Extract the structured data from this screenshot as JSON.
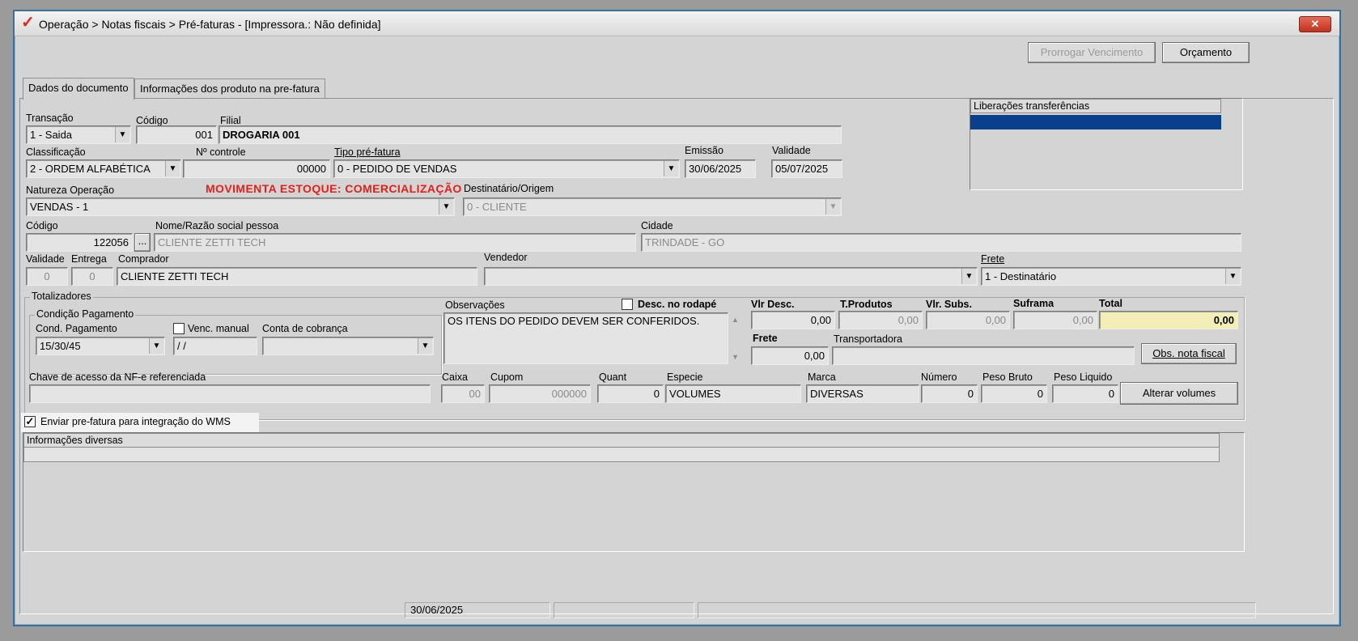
{
  "window": {
    "title": "Operação > Notas fiscais > Pré-faturas - [Impressora.: Não definida]",
    "close_label": "✕"
  },
  "toolbar": {
    "prorrogar_label": "Prorrogar Vencimento",
    "orcamento_label": "Orçamento"
  },
  "tabs": [
    {
      "label": "Dados do documento"
    },
    {
      "label": "Informações dos produto na pre-fatura"
    }
  ],
  "form": {
    "transacao": {
      "label": "Transação",
      "value": "1 - Saida"
    },
    "codigo_filial": {
      "label": "Código",
      "value": "001"
    },
    "filial": {
      "label": "Filial",
      "value": "DROGARIA 001"
    },
    "classificacao": {
      "label": "Classificação",
      "value": "2 - ORDEM ALFABÉTICA"
    },
    "n_controle": {
      "label": "Nº controle",
      "value": "00000"
    },
    "tipo_prefatura": {
      "label": "Tipo pré-fatura",
      "value": "0  - PEDIDO DE VENDAS"
    },
    "emissao": {
      "label": "Emissão",
      "value": "30/06/2025"
    },
    "validade_doc": {
      "label": "Validade",
      "value": "05/07/2025"
    },
    "natureza": {
      "label": "Natureza  Operação",
      "value": "VENDAS - 1"
    },
    "movimenta_estoque": "MOVIMENTA ESTOQUE: COMERCIALIZAÇÃO",
    "destinatario": {
      "label": "Destinatário/Origem",
      "value": "0 - CLIENTE"
    },
    "codigo_pessoa": {
      "label": "Código",
      "value": "122056",
      "lookup": "..."
    },
    "nome_pessoa": {
      "label": "Nome/Razão social pessoa",
      "value": "CLIENTE ZETTI TECH"
    },
    "cidade": {
      "label": "Cidade",
      "value": "TRINDADE - GO"
    },
    "validade": {
      "label": "Validade",
      "value": "0"
    },
    "entrega": {
      "label": "Entrega",
      "value": "0"
    },
    "comprador": {
      "label": "Comprador",
      "value": "CLIENTE ZETTI TECH"
    },
    "vendedor": {
      "label": "Vendedor",
      "value": ""
    },
    "frete_tipo": {
      "label": "Frete",
      "value": "1 - Destinatário"
    }
  },
  "liberacoes": {
    "header": "Liberações transferências"
  },
  "totalizadores": {
    "title": "Totalizadores",
    "condicao_title": "Condição Pagamento",
    "cond_pagamento": {
      "label": "Cond. Pagamento",
      "value": "15/30/45"
    },
    "venc_manual": {
      "label": "Venc. manual",
      "value": "/ /"
    },
    "conta_cobranca": {
      "label": "Conta de cobrança",
      "value": ""
    },
    "observacoes": {
      "label": "Observações",
      "value": "OS ITENS DO PEDIDO DEVEM SER CONFERIDOS."
    },
    "desc_rodape": "Desc. no rodapé",
    "vlr_desc": {
      "label": "Vlr Desc.",
      "value": "0,00"
    },
    "t_produtos": {
      "label": "T.Produtos",
      "value": "0,00"
    },
    "vlr_subs": {
      "label": "Vlr. Subs.",
      "value": "0,00"
    },
    "suframa": {
      "label": "Suframa",
      "value": "0,00"
    },
    "total": {
      "label": "Total",
      "value": "0,00"
    },
    "frete": {
      "label": "Frete",
      "value": "0,00"
    },
    "transportadora": {
      "label": "Transportadora",
      "value": ""
    },
    "obs_nota_fiscal_label": "Obs. nota fiscal",
    "chave_acesso": {
      "label": "Chave de acesso da NF-e referenciada",
      "value": ""
    },
    "caixa": {
      "label": "Caixa",
      "value": "00"
    },
    "cupom": {
      "label": "Cupom",
      "value": "000000"
    },
    "quant": {
      "label": "Quant",
      "value": "0"
    },
    "especie": {
      "label": "Especie",
      "value": "VOLUMES"
    },
    "marca": {
      "label": "Marca",
      "value": "DIVERSAS"
    },
    "numero": {
      "label": "Número",
      "value": "0"
    },
    "peso_bruto": {
      "label": "Peso Bruto",
      "value": "0"
    },
    "peso_liquido": {
      "label": "Peso Liquido",
      "value": "0"
    },
    "alterar_volumes_label": "Alterar volumes"
  },
  "wms": {
    "label": "Enviar pre-fatura para integração do WMS",
    "checked": "✓"
  },
  "info_diversas": {
    "header": "Informações diversas"
  },
  "statusbar": {
    "date": "30/06/2025"
  },
  "colors": {
    "accent_blue": "#0a3f8e",
    "total_highlight": "#f2eeb6",
    "warning_red": "#e32019"
  }
}
